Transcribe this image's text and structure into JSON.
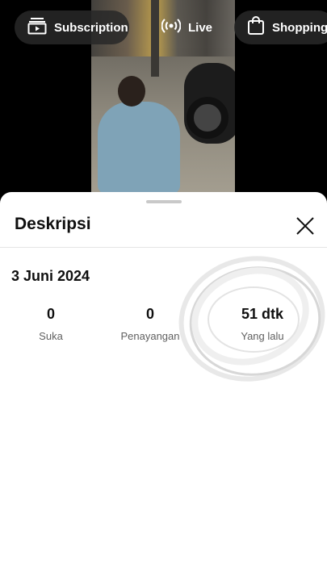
{
  "top_bar": {
    "subscription_label": "Subscription",
    "live_label": "Live",
    "shopping_label": "Shopping"
  },
  "description_sheet": {
    "title": "Deskripsi",
    "date": "3 Juni 2024",
    "stats": [
      {
        "value": "0",
        "label": "Suka"
      },
      {
        "value": "0",
        "label": "Penayangan"
      },
      {
        "value": "51 dtk",
        "label": "Yang lalu"
      }
    ]
  },
  "icons": [
    "subscriptions-icon",
    "live-icon",
    "shopping-bag-icon",
    "close-icon"
  ]
}
